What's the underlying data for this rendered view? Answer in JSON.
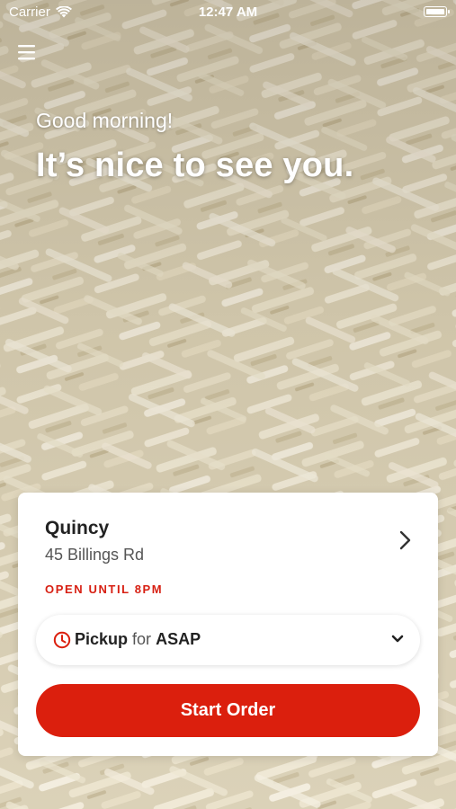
{
  "status_bar": {
    "carrier": "Carrier",
    "time": "12:47 AM"
  },
  "greeting": {
    "subtitle": "Good morning!",
    "headline": "It’s nice to see you."
  },
  "store": {
    "name": "Quincy",
    "address": "45 Billings Rd",
    "hours": "OPEN UNTIL 8PM"
  },
  "order_mode": {
    "mode": "Pickup",
    "connector": "for",
    "time": "ASAP"
  },
  "actions": {
    "start_order": "Start Order"
  },
  "icons": {
    "menu": "hamburger-menu-icon",
    "wifi": "wifi-icon",
    "battery": "battery-icon",
    "store_chevron": "chevron-right-icon",
    "clock": "clock-icon",
    "dropdown": "chevron-down-icon"
  },
  "colors": {
    "accent": "#db1f0d",
    "hours_text": "#d71f12",
    "card_background": "#ffffff",
    "background_tone": "#d8ceb3"
  }
}
